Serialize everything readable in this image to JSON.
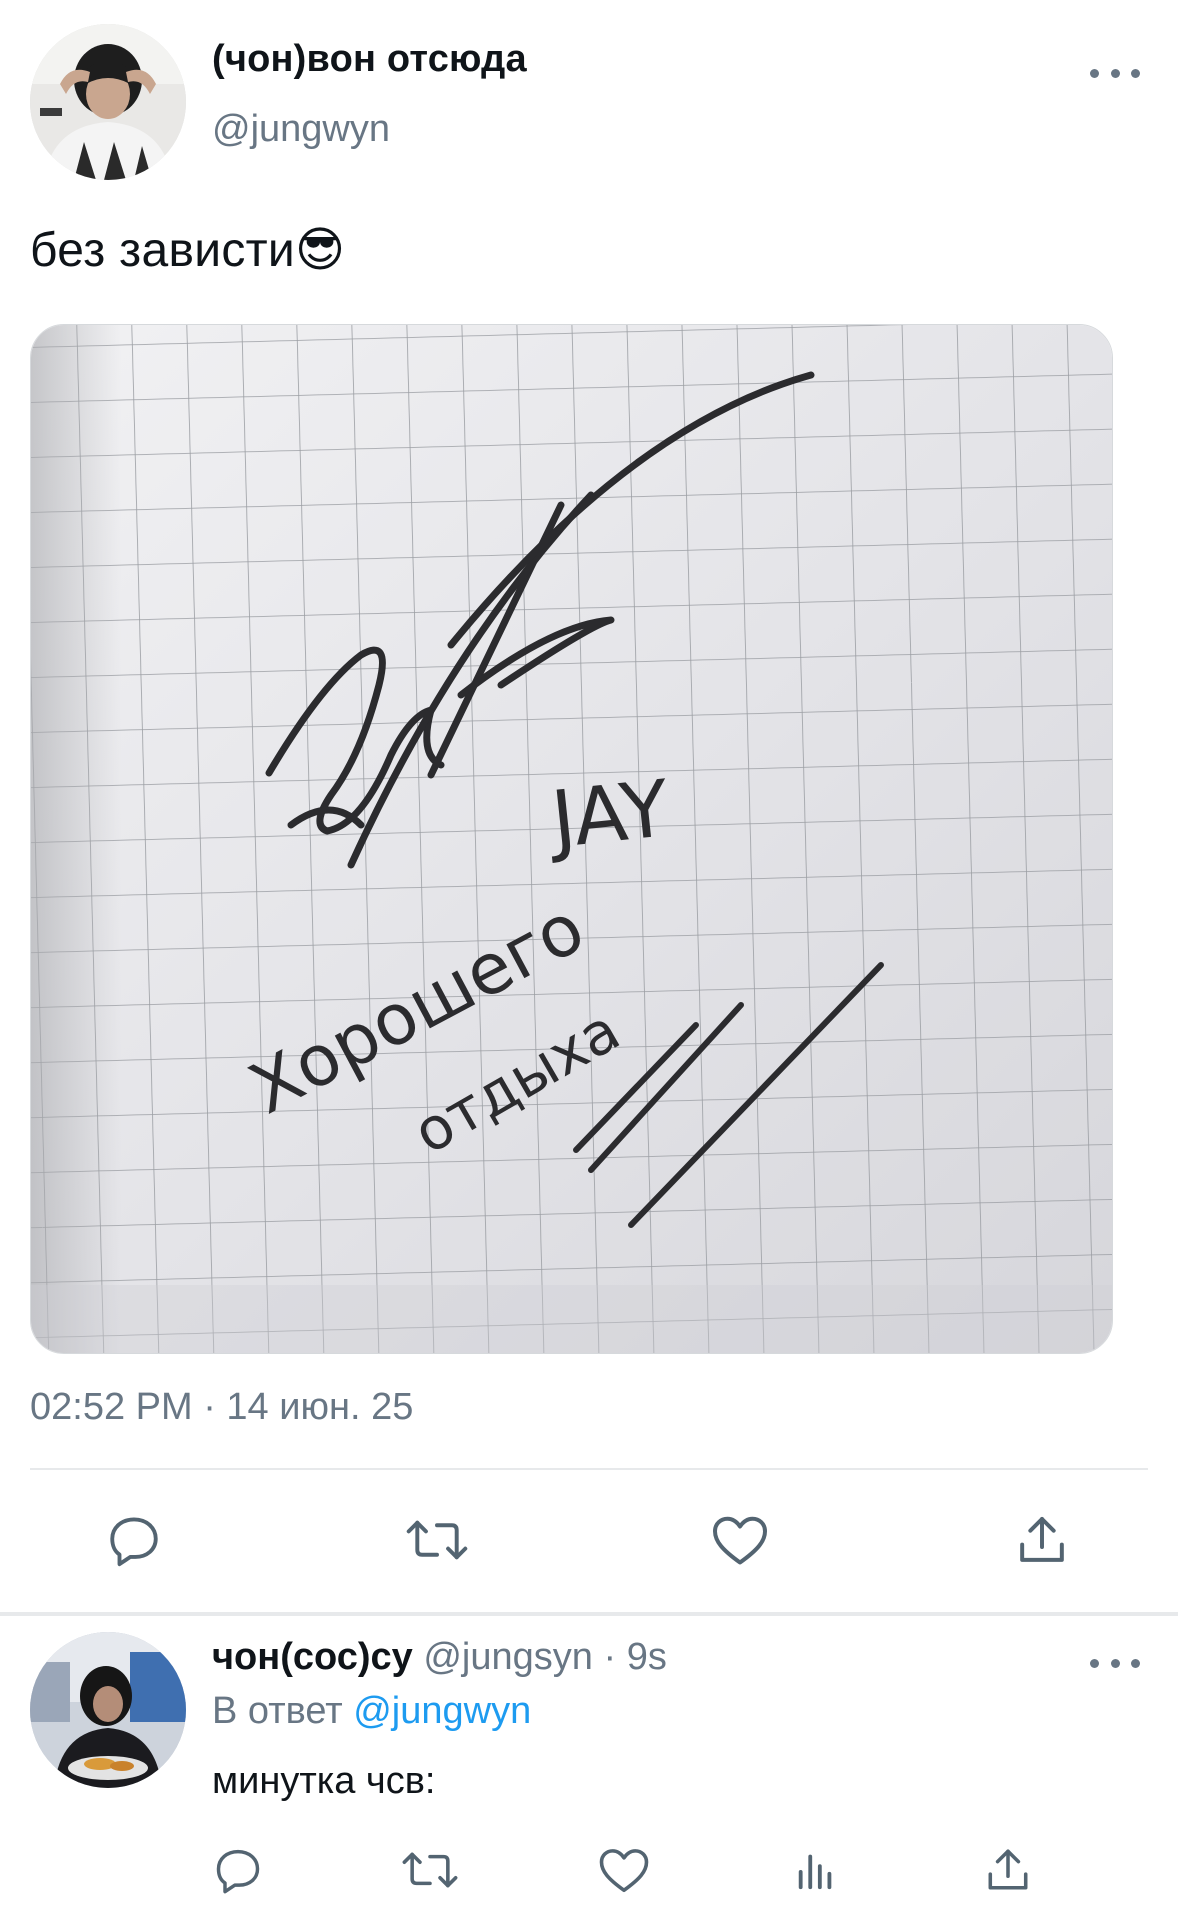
{
  "main_tweet": {
    "author_name": "(чон)вон отсюда",
    "author_handle": "@jungwyn",
    "text": "без зависти😎",
    "media": {
      "handwriting_line1": "JAY",
      "handwriting_line2": "Хорошего",
      "handwriting_line3": "отдыха"
    },
    "timestamp": "02:52 PM · 14 июн. 25",
    "icons": {
      "reply": "reply-icon",
      "retweet": "retweet-icon",
      "like": "heart-icon",
      "share": "share-icon",
      "more": "more-icon"
    }
  },
  "reply_tweet": {
    "author_name": "чон(сос)су",
    "author_handle": "@jungsyn",
    "separator": "·",
    "time": "9s",
    "reply_to_label": "В ответ",
    "reply_to_mention": "@jungwyn",
    "text": "минутка чсв:",
    "icons": {
      "reply": "reply-icon",
      "retweet": "retweet-icon",
      "like": "heart-icon",
      "stats": "stats-icon",
      "share": "share-icon",
      "more": "more-icon"
    }
  },
  "colors": {
    "text_primary": "#0f1419",
    "text_secondary": "#687684",
    "link": "#1d9bf0",
    "divider": "#e7e9eb"
  }
}
